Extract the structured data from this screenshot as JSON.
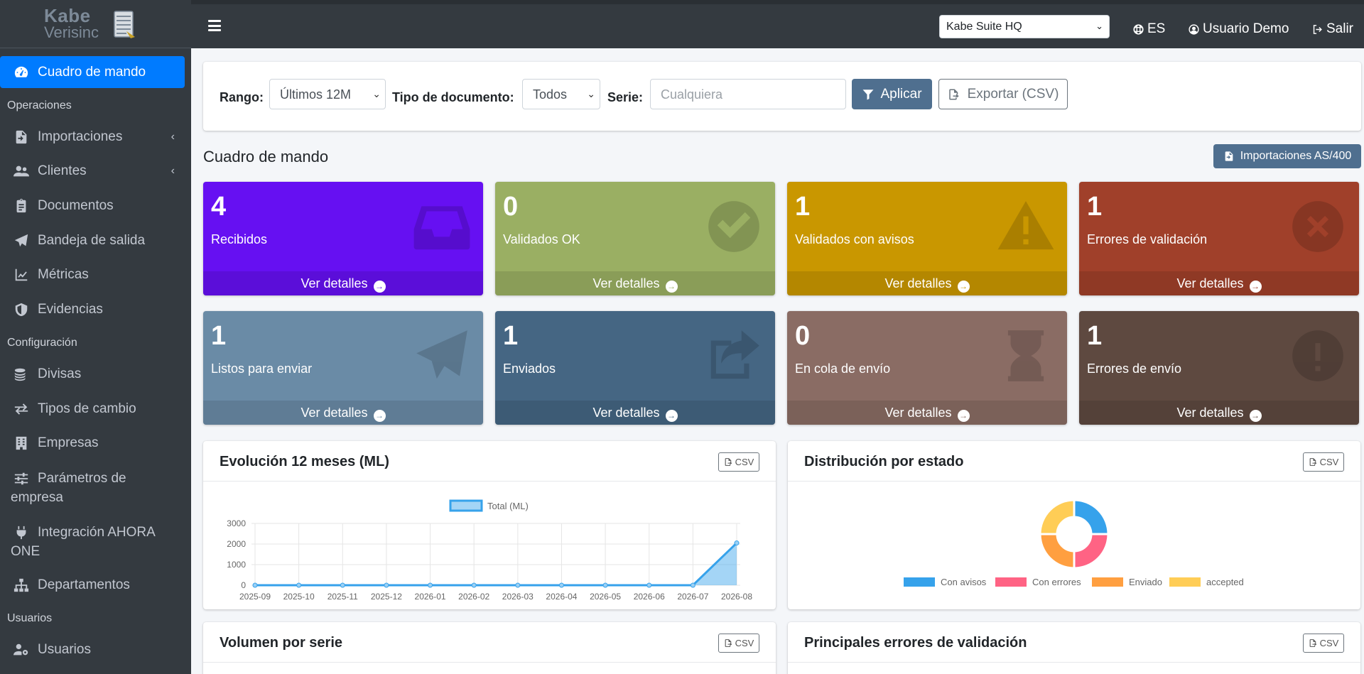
{
  "brand": {
    "name_line1": "Kabe",
    "name_line2": "Verisinc"
  },
  "sidebar": {
    "active": {
      "label": "Cuadro de mando",
      "icon": "tachometer-icon"
    },
    "sections": [
      {
        "header": "Operaciones"
      },
      {
        "header": "Configuración"
      },
      {
        "header": "Usuarios"
      }
    ],
    "items": [
      {
        "label": "Importaciones",
        "icon": "file-import-icon"
      },
      {
        "label": "Clientes",
        "icon": "users-icon"
      },
      {
        "label": "Documentos",
        "icon": "clipboard-icon"
      },
      {
        "label": "Bandeja de salida",
        "icon": "paper-plane-icon"
      },
      {
        "label": "Métricas",
        "icon": "chart-line-icon"
      },
      {
        "label": "Evidencias",
        "icon": "shield-icon"
      },
      {
        "label": "Divisas",
        "icon": "coins-icon"
      },
      {
        "label": "Tipos de cambio",
        "icon": "exchange-icon"
      },
      {
        "label": "Empresas",
        "icon": "building-icon"
      },
      {
        "label_line1": "Parámetros de",
        "label_line2": "empresa",
        "icon": "sliders-icon"
      },
      {
        "label_line1": "Integración AHORA",
        "label_line2": "ONE",
        "icon": "plug-icon"
      },
      {
        "label": "Departamentos",
        "icon": "sitemap-icon"
      },
      {
        "label": "Usuarios",
        "icon": "users-cog-icon"
      }
    ]
  },
  "topbar": {
    "company": "Kabe Suite HQ",
    "language": "ES",
    "user": "Usuario Demo",
    "logout": "Salir"
  },
  "filters": {
    "range_label": "Rango:",
    "range_value": "Últimos 12M",
    "doctype_label": "Tipo de documento:",
    "doctype_value": "Todos",
    "serie_label": "Serie:",
    "serie_placeholder": "Cualquiera",
    "apply": "Aplicar",
    "export": "Exportar (CSV)"
  },
  "page": {
    "title": "Cuadro de mando",
    "as400_button": "Importaciones AS/400"
  },
  "boxes": [
    {
      "value": "4",
      "label": "Recibidos",
      "link": "Ver detalles",
      "color": "#6610f2",
      "icon": "inbox-icon"
    },
    {
      "value": "0",
      "label": "Validados OK",
      "link": "Ver detalles",
      "color": "#9aaf63",
      "icon": "check-circle-icon"
    },
    {
      "value": "1",
      "label": "Validados con avisos",
      "link": "Ver detalles",
      "color": "#c99700",
      "icon": "warning-icon"
    },
    {
      "value": "1",
      "label": "Errores de validación",
      "link": "Ver detalles",
      "color": "#a0402a",
      "icon": "times-circle-icon"
    },
    {
      "value": "1",
      "label": "Listos para enviar",
      "link": "Ver detalles",
      "color": "#6a8ba6",
      "icon": "paper-plane-icon"
    },
    {
      "value": "1",
      "label": "Enviados",
      "link": "Ver detalles",
      "color": "#456683",
      "icon": "share-square-icon"
    },
    {
      "value": "0",
      "label": "En cola de envío",
      "link": "Ver detalles",
      "color": "#8a6c64",
      "icon": "hourglass-icon"
    },
    {
      "value": "1",
      "label": "Errores de envío",
      "link": "Ver detalles",
      "color": "#5e4940",
      "icon": "exclamation-circle-icon"
    }
  ],
  "cards": {
    "evolution_title": "Evolución 12 meses (ML)",
    "distribution_title": "Distribución por estado",
    "volume_title": "Volumen por serie",
    "errors_title": "Principales errores de validación",
    "csv_label": "CSV"
  },
  "chart_data": [
    {
      "type": "area",
      "title": "Evolución 12 meses (ML)",
      "x": [
        "2025-09",
        "2025-10",
        "2025-11",
        "2025-12",
        "2026-01",
        "2026-02",
        "2026-03",
        "2026-04",
        "2026-05",
        "2026-06",
        "2026-07",
        "2026-08"
      ],
      "series": [
        {
          "name": "Total (ML)",
          "values": [
            0,
            0,
            0,
            0,
            0,
            0,
            0,
            0,
            0,
            0,
            0,
            2050
          ]
        }
      ],
      "yticks": [
        "3000",
        "2000",
        "1000",
        "0"
      ],
      "ylim": [
        0,
        3000
      ],
      "grid": true,
      "legend": "top"
    },
    {
      "type": "pie",
      "title": "Distribución por estado",
      "categories": [
        "Con avisos",
        "Con errores",
        "Enviado",
        "accepted"
      ],
      "values": [
        1,
        1,
        1,
        1
      ],
      "colors": [
        "#36a2eb",
        "#ff6384",
        "#ff9f40",
        "#ffcd56"
      ],
      "legend": "bottom"
    }
  ]
}
